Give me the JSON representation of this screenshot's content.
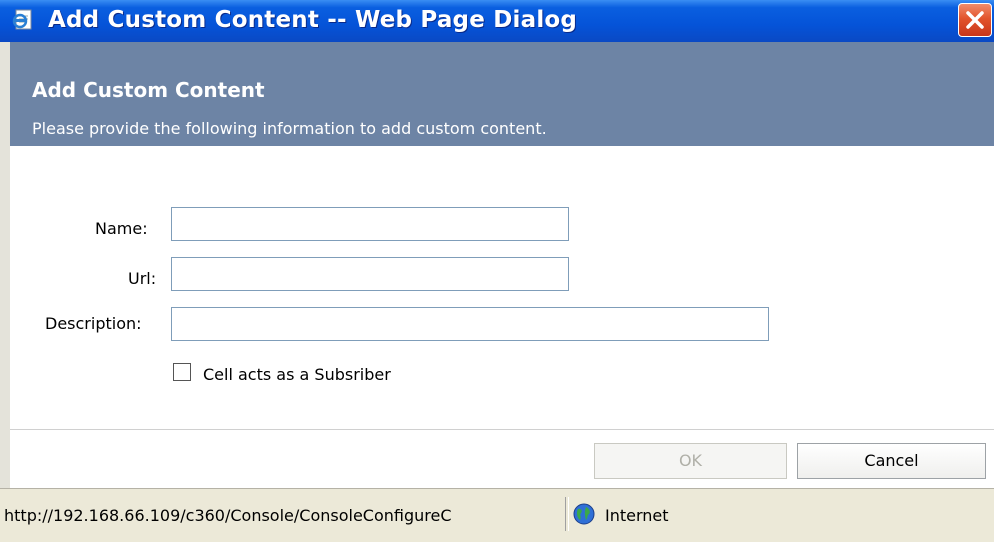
{
  "window": {
    "title": "Add Custom Content -- Web Page Dialog",
    "close_icon": "close-icon",
    "app_icon": "ie-page-icon"
  },
  "header": {
    "title": "Add Custom Content",
    "subtitle": "Please provide the following information to add custom content."
  },
  "form": {
    "name_label": "Name:",
    "name_value": "",
    "url_label": "Url:",
    "url_value": "",
    "description_label": "Description:",
    "description_value": "",
    "subscriber_label": "Cell acts as a Subsriber",
    "subscriber_checked": false
  },
  "buttons": {
    "ok_label": "OK",
    "ok_enabled": false,
    "cancel_label": "Cancel"
  },
  "statusbar": {
    "url": "http://192.168.66.109/c360/Console/ConsoleConfigureC",
    "zone": "Internet",
    "zone_icon": "globe-icon"
  },
  "colors": {
    "titlebar": "#0553d8",
    "header": "#6d84a5",
    "close_button": "#e2542c",
    "statusbar": "#ece9d8"
  }
}
